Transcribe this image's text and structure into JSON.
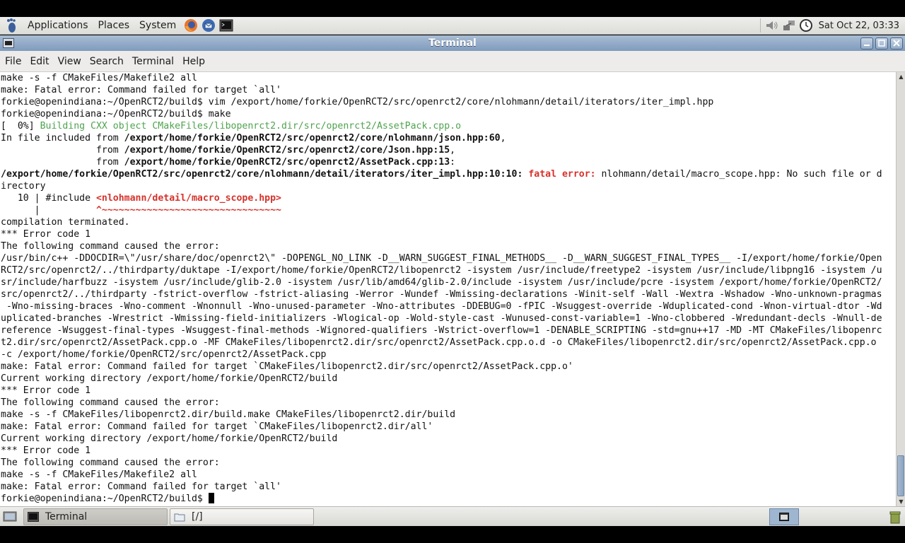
{
  "top_panel": {
    "menus": [
      "Applications",
      "Places",
      "System"
    ],
    "clock": "Sat Oct 22, 03:33"
  },
  "window": {
    "title": "Terminal"
  },
  "menubar": {
    "items": [
      "File",
      "Edit",
      "View",
      "Search",
      "Terminal",
      "Help"
    ]
  },
  "terminal": {
    "lines": [
      "make -s -f CMakeFiles/Makefile2 all",
      "make: Fatal error: Command failed for target `all'",
      "forkie@openindiana:~/OpenRCT2/build$ vim /export/home/forkie/OpenRCT2/src/openrct2/core/nlohmann/detail/iterators/iter_impl.hpp",
      "forkie@openindiana:~/OpenRCT2/build$ make",
      {
        "prefix": "[  0%] ",
        "green": "Building CXX object CMakeFiles/libopenrct2.dir/src/openrct2/AssetPack.cpp.o"
      },
      {
        "prefix": "In file included from ",
        "bold": "/export/home/forkie/OpenRCT2/src/openrct2/core/nlohmann/json.hpp:60",
        "suffix": ","
      },
      {
        "prefix": "                 from ",
        "bold": "/export/home/forkie/OpenRCT2/src/openrct2/core/Json.hpp:15",
        "suffix": ","
      },
      {
        "prefix": "                 from ",
        "bold": "/export/home/forkie/OpenRCT2/src/openrct2/AssetPack.cpp:13",
        "suffix": ":"
      },
      {
        "bold": "/export/home/forkie/OpenRCT2/src/openrct2/core/nlohmann/detail/iterators/iter_impl.hpp:10:10: ",
        "red": "fatal error: ",
        "suffix": "nlohmann/detail/macro_scope.hpp: No such file or d"
      },
      "irectory",
      {
        "prefix": "   10 | #include ",
        "red": "<nlohmann/detail/macro_scope.hpp>"
      },
      {
        "prefix": "      |          ",
        "red": "^~~~~~~~~~~~~~~~~~~~~~~~~~~~~~~~~"
      },
      "compilation terminated.",
      "*** Error code 1",
      "The following command caused the error:",
      "/usr/bin/c++ -DDOCDIR=\\\"/usr/share/doc/openrct2\\\" -DOPENGL_NO_LINK -D__WARN_SUGGEST_FINAL_METHODS__ -D__WARN_SUGGEST_FINAL_TYPES__ -I/export/home/forkie/Open",
      "RCT2/src/openrct2/../thirdparty/duktape -I/export/home/forkie/OpenRCT2/libopenrct2 -isystem /usr/include/freetype2 -isystem /usr/include/libpng16 -isystem /u",
      "sr/include/harfbuzz -isystem /usr/include/glib-2.0 -isystem /usr/lib/amd64/glib-2.0/include -isystem /usr/include/pcre -isystem /export/home/forkie/OpenRCT2/",
      "src/openrct2/../thirdparty -fstrict-overflow -fstrict-aliasing -Werror -Wundef -Wmissing-declarations -Winit-self -Wall -Wextra -Wshadow -Wno-unknown-pragmas",
      " -Wno-missing-braces -Wno-comment -Wnonnull -Wno-unused-parameter -Wno-attributes -DDEBUG=0 -fPIC -Wsuggest-override -Wduplicated-cond -Wnon-virtual-dtor -Wd",
      "uplicated-branches -Wrestrict -Wmissing-field-initializers -Wlogical-op -Wold-style-cast -Wunused-const-variable=1 -Wno-clobbered -Wredundant-decls -Wnull-de",
      "reference -Wsuggest-final-types -Wsuggest-final-methods -Wignored-qualifiers -Wstrict-overflow=1 -DENABLE_SCRIPTING -std=gnu++17 -MD -MT CMakeFiles/libopenrc",
      "t2.dir/src/openrct2/AssetPack.cpp.o -MF CMakeFiles/libopenrct2.dir/src/openrct2/AssetPack.cpp.o.d -o CMakeFiles/libopenrct2.dir/src/openrct2/AssetPack.cpp.o",
      "-c /export/home/forkie/OpenRCT2/src/openrct2/AssetPack.cpp",
      "make: Fatal error: Command failed for target `CMakeFiles/libopenrct2.dir/src/openrct2/AssetPack.cpp.o'",
      "Current working directory /export/home/forkie/OpenRCT2/build",
      "*** Error code 1",
      "The following command caused the error:",
      "make -s -f CMakeFiles/libopenrct2.dir/build.make CMakeFiles/libopenrct2.dir/build",
      "make: Fatal error: Command failed for target `CMakeFiles/libopenrct2.dir/all'",
      "Current working directory /export/home/forkie/OpenRCT2/build",
      "*** Error code 1",
      "The following command caused the error:",
      "make -s -f CMakeFiles/Makefile2 all",
      "make: Fatal error: Command failed for target `all'",
      {
        "prefix": "forkie@openindiana:~/OpenRCT2/build$ ",
        "cursor": true
      }
    ]
  },
  "taskbar": {
    "tasks": [
      {
        "label": "Terminal",
        "icon": "terminal-icon",
        "active": true
      },
      {
        "label": "[/]",
        "icon": "folder-icon",
        "active": false
      }
    ]
  },
  "colors": {
    "title_bar": "#8fa9c8",
    "green_text": "#4ea44e",
    "error_red": "#d7322b"
  }
}
